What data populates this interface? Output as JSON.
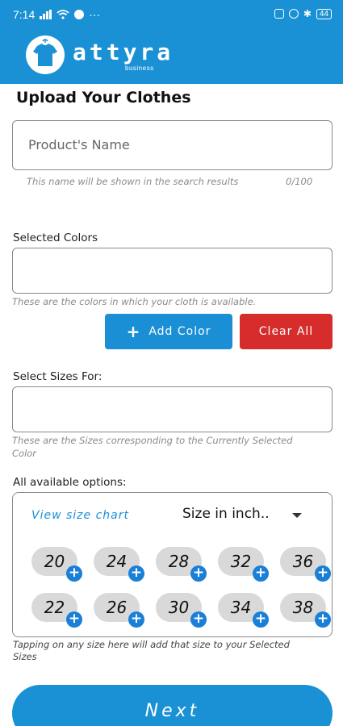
{
  "status_bar": {
    "time": "7:14",
    "more": "···",
    "battery": "44"
  },
  "brand": {
    "name": "attyra",
    "subtitle": "business"
  },
  "page_title": "Upload Your Clothes",
  "product_name": {
    "placeholder": "Product's Name",
    "helper": "This name will be shown in the search results",
    "counter": "0/100"
  },
  "colors_section": {
    "label": "Selected Colors",
    "helper": "These are the colors in which your cloth is available."
  },
  "buttons": {
    "add_color": "Add Color",
    "clear_all": "Clear All",
    "next": "Next"
  },
  "sizes_section": {
    "label": "Select Sizes For:",
    "helper": "These are the Sizes corresponding to the Currently Selected Color"
  },
  "options_section": {
    "label": "All available options:",
    "size_chart_link": "View size chart",
    "unit_selected": "Size in inch..",
    "sizes_row1": [
      "20",
      "24",
      "28",
      "32",
      "36"
    ],
    "sizes_row2": [
      "22",
      "26",
      "30",
      "34",
      "38"
    ],
    "hint": "Tapping on any size here will add that size to your Selected Sizes"
  },
  "colors": {
    "primary": "#1a91d4",
    "danger": "#d62c2c",
    "chip": "#d9d9d9"
  }
}
